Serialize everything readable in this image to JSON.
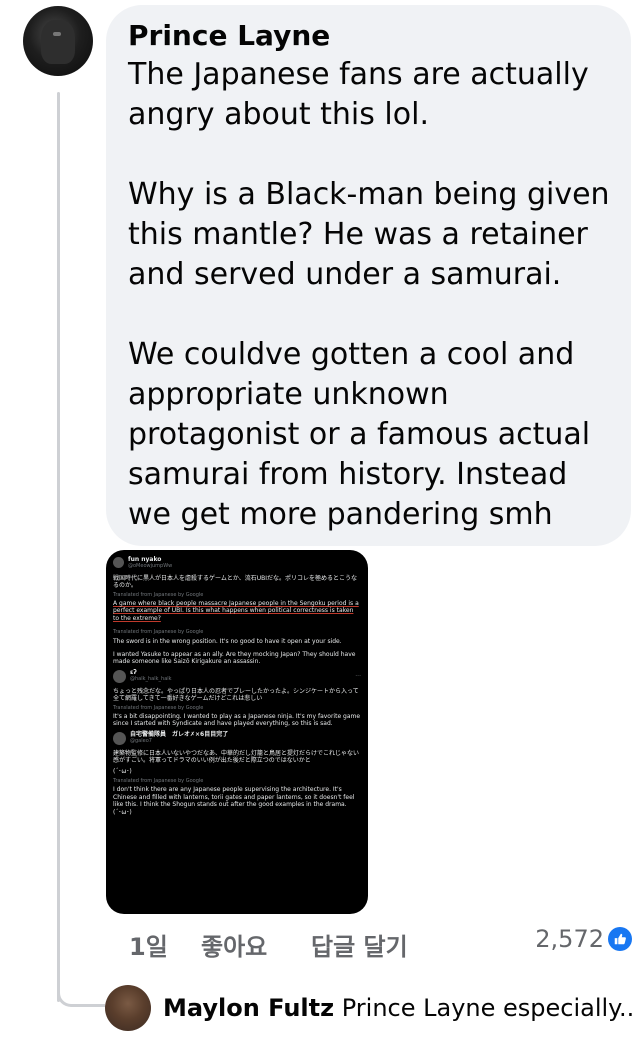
{
  "comment": {
    "author": "Prince Layne",
    "text": "The Japanese fans are actually angry about this lol.\n\nWhy is a Black-man being given this mantle? He was a retainer and served under a samurai.\n\nWe couldve gotten a cool and appropriate unknown protagonist or a famous actual samurai from history. Instead we get more pandering smh"
  },
  "screenshot": {
    "poster_name": "fun nyako",
    "poster_handle": "@oMeowjumpWw",
    "post_jp": "戦国時代に黒人が日本人を虐殺するゲームとか、流石UBIだな。ポリコレを極めるとこうなるのか。",
    "translated_label": "Translated from Japanese by Google",
    "post_en": "A game where black people massacre Japanese people in the Sengoku period is a perfect example of UBI. Is this what happens when political correctness is taken to the extreme?",
    "reply1_en": "The sword is in the wrong position. It's no good to have it open at your side.",
    "reply2_en": "I wanted Yasuke to appear as an ally. Are they mocking Japan? They should have made someone like Saizō Kirigakure an assassin.",
    "user2_name": "ɛʔ",
    "user2_handle": "@halk_halk_halk",
    "user2_jp": "ちょっと残念だな。やっぱり日本人の忍者でプレーしたかったよ。シンジケートから入って全て網羅してきて一番好きなゲームだけどこれは悲しい",
    "user2_en": "It's a bit disappointing. I wanted to play as a Japanese ninja. It's my favorite game since I started with Syndicate and have played everything, so this is sad.",
    "user3_name": "自宅警備隊員　ガレオ✗×6目目完了",
    "user3_handle": "@galeo7",
    "user3_jp": "建築物監修に日本人いないやつだなあ、中華的だし灯籠と鳥居と提灯だらけでこれじゃない感がすごい。将軍ってドラマのいい例が出た後だと際立つのではないかと",
    "user3_emote": "(´･ω･)",
    "user3_en": "I don't think there are any Japanese people supervising the architecture. It's Chinese and filled with lanterns, torii gates and paper lanterns, so it doesn't feel like this. I think the Shogun stands out after the good examples in the drama.",
    "last_line": "(´･ω･)"
  },
  "footer": {
    "time": "1일",
    "like": "좋아요",
    "reply": "답글 달기",
    "like_count": "2,572"
  },
  "reply": {
    "author": "Maylon Fultz",
    "preview": "Prince Layne especially..."
  },
  "colors": {
    "bubble": "#f0f2f5",
    "like_blue": "#1877f2",
    "muted": "#65676b"
  }
}
